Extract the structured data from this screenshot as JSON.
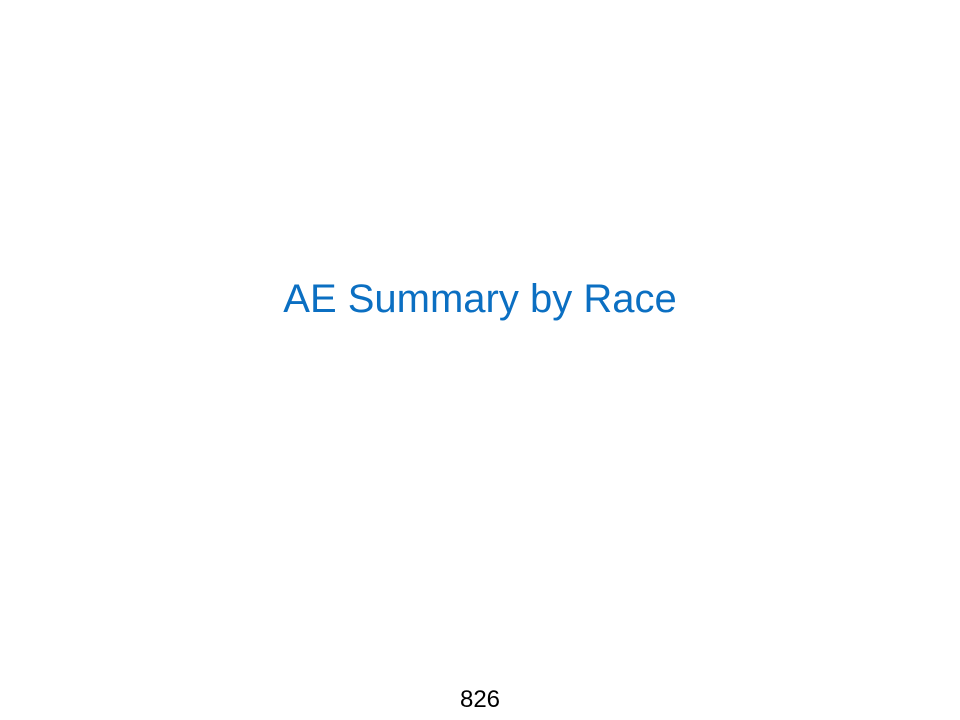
{
  "slide": {
    "title": "AE Summary by Race",
    "page_number": "826",
    "title_color": "#0b6fc2"
  }
}
